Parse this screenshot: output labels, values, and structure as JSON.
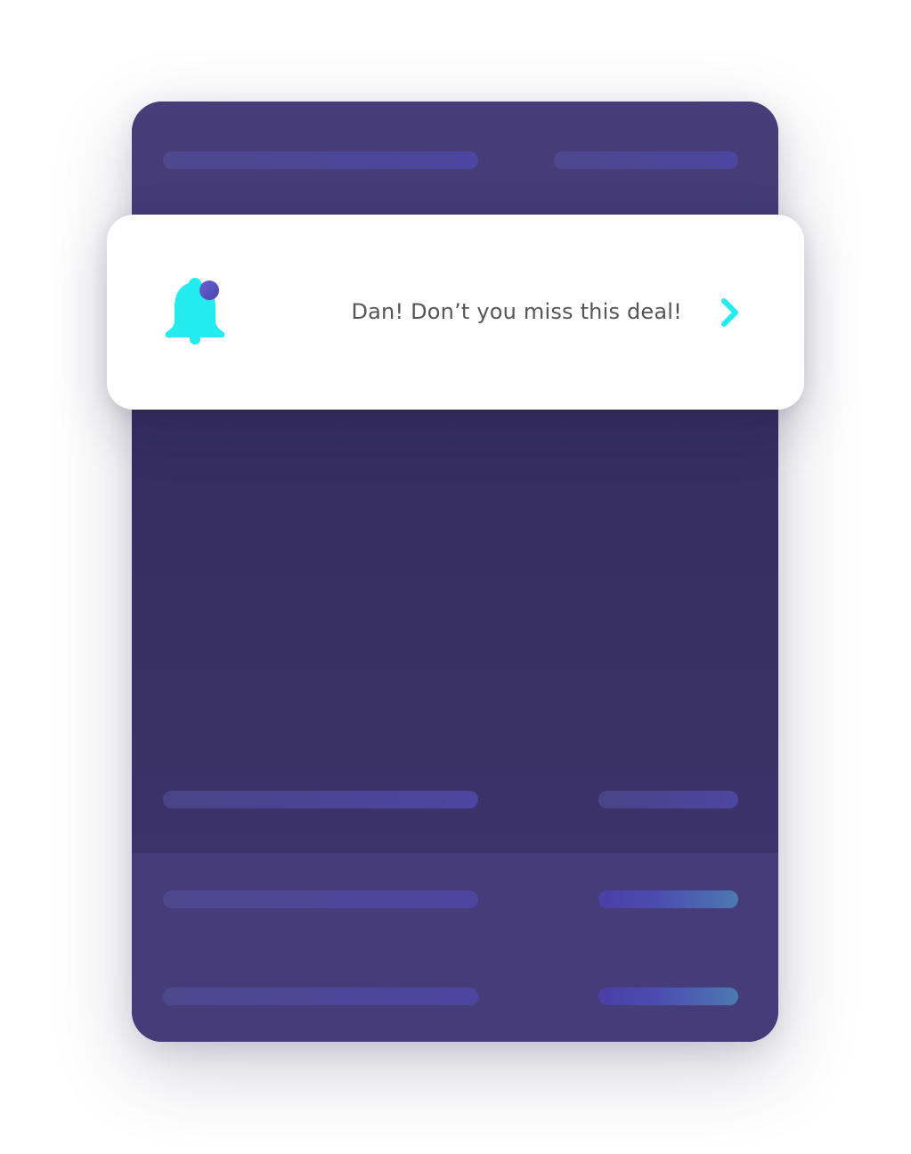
{
  "notification": {
    "message": "Dan! Don’t you miss this deal!",
    "icon": "bell-icon",
    "badge_icon": "notification-dot-icon",
    "action_icon": "chevron-right-icon"
  },
  "colors": {
    "background": "#ffffff",
    "card_top": "#463d79",
    "card_middle": "#3b3369",
    "card_bottom": "#453c79",
    "accent_cyan": "#24ecee",
    "badge_purple": "#5b55c4",
    "text_gray": "#555555"
  }
}
